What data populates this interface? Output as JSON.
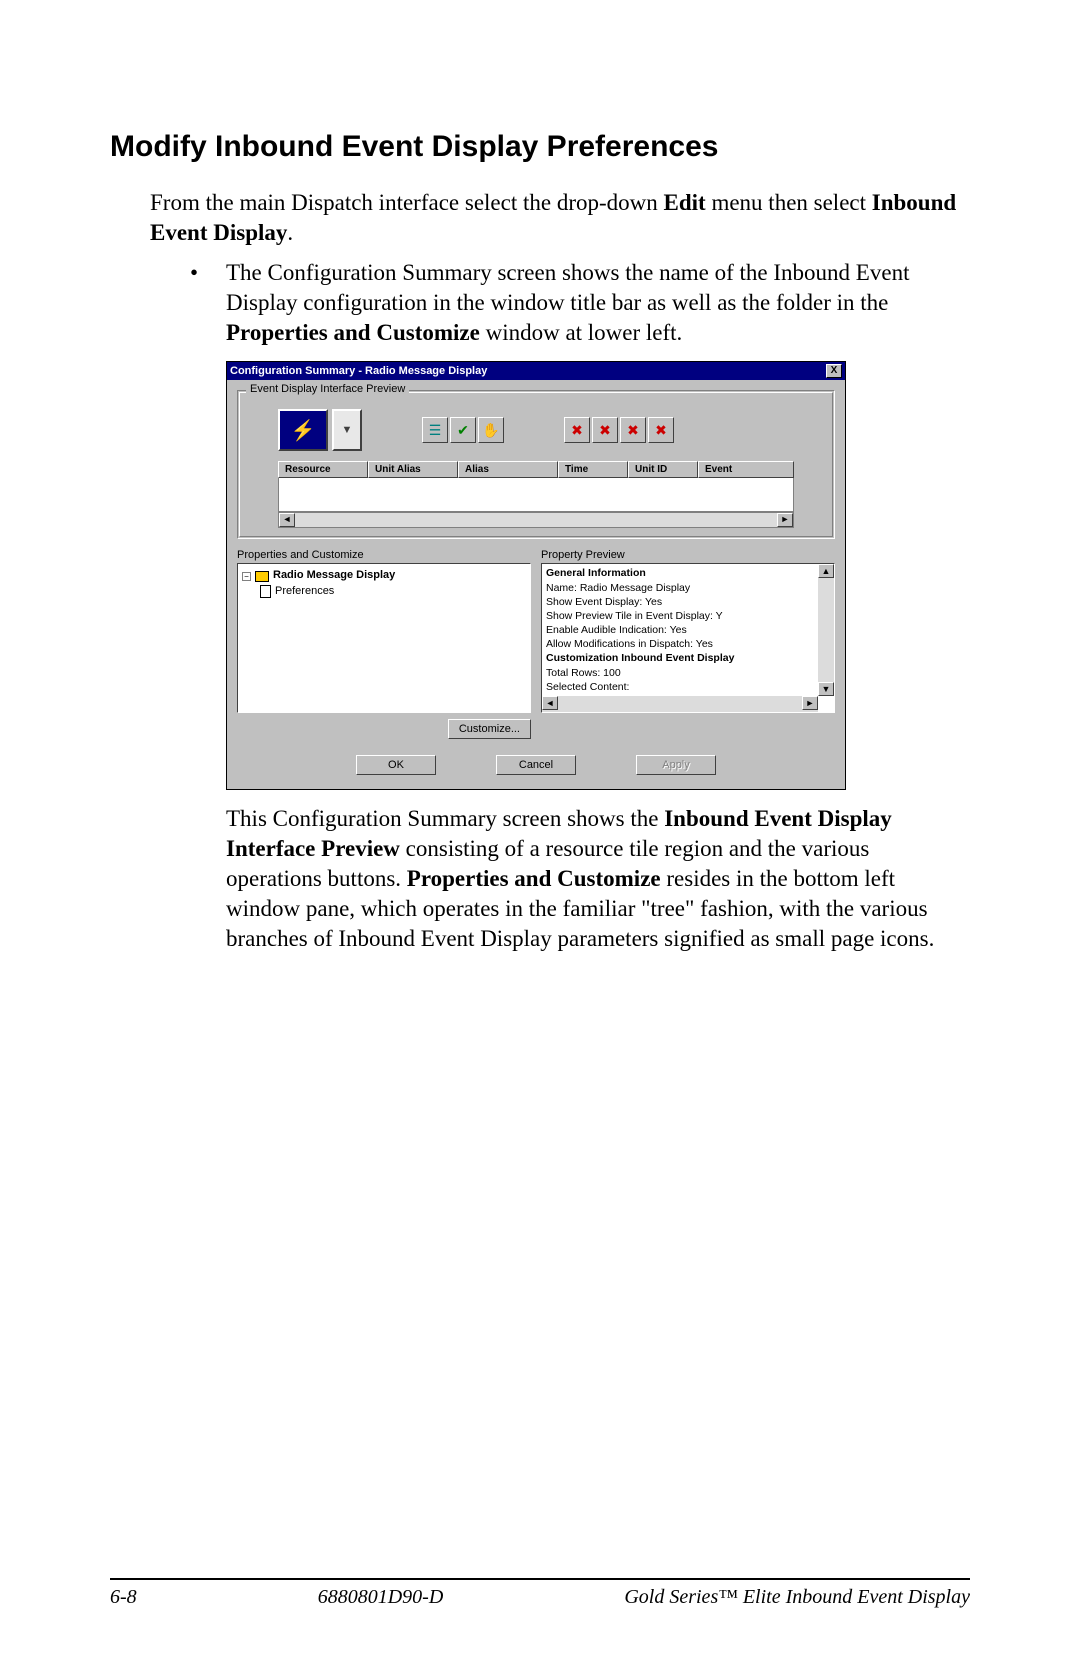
{
  "heading": "Modify Inbound Event Display Preferences",
  "intro": {
    "pre": "From the main Dispatch interface select the drop-down ",
    "bold1": "Edit",
    "mid": " menu then select ",
    "bold2": "Inbound Event Display",
    "post": "."
  },
  "bullet1": {
    "pre": "The Configuration Summary screen shows the name of the Inbound Event Display configuration in the window title bar as well as the folder in the ",
    "bold": "Properties and Customize",
    "post": " window at lower left."
  },
  "dialog": {
    "title": "Configuration Summary - Radio Message Display",
    "close": "X",
    "preview_label": "Event Display Interface Preview",
    "columns": [
      "Resource",
      "Unit Alias",
      "Alias",
      "Time",
      "Unit ID",
      "Event"
    ],
    "props_label": "Properties and Customize",
    "tree_root": "Radio Message Display",
    "tree_child": "Preferences",
    "customize_btn": "Customize...",
    "proppreview_label": "Property Preview",
    "prop_lines": [
      "General Information",
      "Name: Radio Message Display",
      "Show Event Display: Yes",
      "Show Preview Tile in Event Display: Y",
      "Enable Audible Indication: Yes",
      "Allow Modifications in Dispatch: Yes",
      "",
      "Customization Inbound Event Display",
      "Total Rows: 100",
      "Selected Content:"
    ],
    "ok": "OK",
    "cancel": "Cancel",
    "apply": "Apply"
  },
  "bullet2": {
    "pre": "This Configuration Summary screen shows the ",
    "bold1": "Inbound Event Display Interface Preview",
    "mid1": " consisting of a resource tile region and the various operations buttons.  ",
    "bold2": "Properties and Customize",
    "post": " resides in the bottom left window pane, which operates in the familiar \"tree\" fashion, with the various branches of Inbound Event Display parameters signified as small page icons."
  },
  "footer": {
    "page": "6-8",
    "docnum": "6880801D90-D",
    "product": "Gold Series™ Elite Inbound Event Display"
  }
}
